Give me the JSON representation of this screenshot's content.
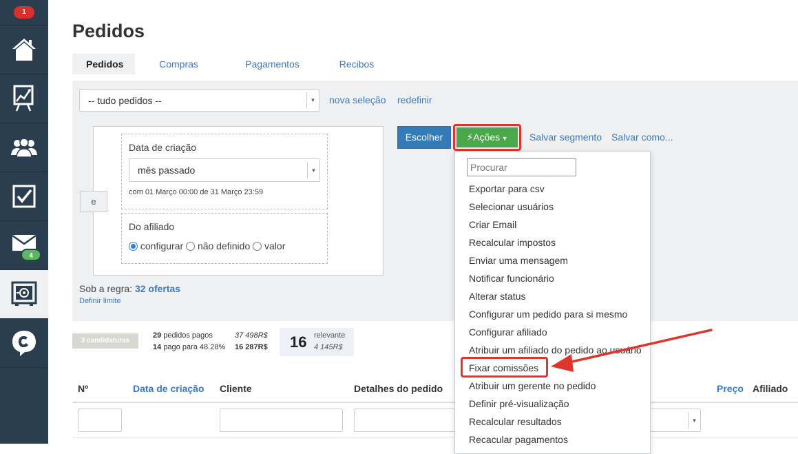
{
  "sidebar": {
    "top_badge": "1",
    "items": [
      {
        "icon": "home-icon"
      },
      {
        "icon": "chart-board-icon"
      },
      {
        "icon": "users-icon"
      },
      {
        "icon": "checkbox-icon"
      },
      {
        "icon": "mail-icon",
        "badge": "4"
      },
      {
        "icon": "safe-icon",
        "active": true
      },
      {
        "icon": "chat-logo-icon"
      }
    ]
  },
  "page": {
    "title": "Pedidos"
  },
  "tabs": [
    "Pedidos",
    "Compras",
    "Pagamentos",
    "Recibos"
  ],
  "filter": {
    "selection": "-- tudo pedidos --",
    "new_selection": "nova seleção",
    "reset": "redefinir",
    "and_label": "e",
    "date_label": "Data de criação",
    "date_value": "mês passado",
    "date_range": "com 01 Março 00:00 de 31 Março 23:59",
    "affiliate_label": "Do afiliado",
    "radio_configure": "configurar",
    "radio_undefined": "não definido",
    "radio_value": "valor",
    "rule_prefix": "Sob a regra:",
    "rule_offers": "32 ofertas",
    "rule_limit": "Definir limite"
  },
  "toolbar": {
    "choose": "Escolher",
    "actions": "Ações",
    "save_segment": "Salvar segmento",
    "save_as": "Salvar como..."
  },
  "actions_menu": {
    "search_placeholder": "Procurar",
    "items": [
      "Exportar para csv",
      "Selecionar usuários",
      "Criar Email",
      "Recalcular impostos",
      "Enviar uma mensagem",
      "Notificar funcionário",
      "Alterar status",
      "Configurar um pedido para si mesmo",
      "Configurar afiliado",
      "Atribuir um afiliado do pedido ao usuário",
      "Fixar comissões",
      "Atribuir um gerente no pedido",
      "Definir pré-visualização",
      "Recalcular resultados",
      "Recacular pagamentos"
    ],
    "highlighted_index": 10
  },
  "stats": {
    "candidatures": "3 candidaturas",
    "paid_count": "29",
    "paid_label": "pedidos pagos",
    "paid_amount": "37 498R$",
    "paid_for_count": "14",
    "paid_for_label": "pago para 48.28%",
    "paid_for_amount": "16 287R$",
    "relevant_count": "16",
    "relevant_label": "relevante",
    "relevant_amount": "4 145R$"
  },
  "table": {
    "headers": {
      "number": "Nº",
      "created": "Data de criação",
      "client": "Cliente",
      "details": "Detalhes do pedido",
      "price": "Preço",
      "affiliate": "Afiliado"
    }
  },
  "colors": {
    "sidebar": "#2b3e50",
    "link": "#3a7abf",
    "primary": "#337ab7",
    "success": "#4aa84a",
    "annotation": "#e0342d"
  }
}
